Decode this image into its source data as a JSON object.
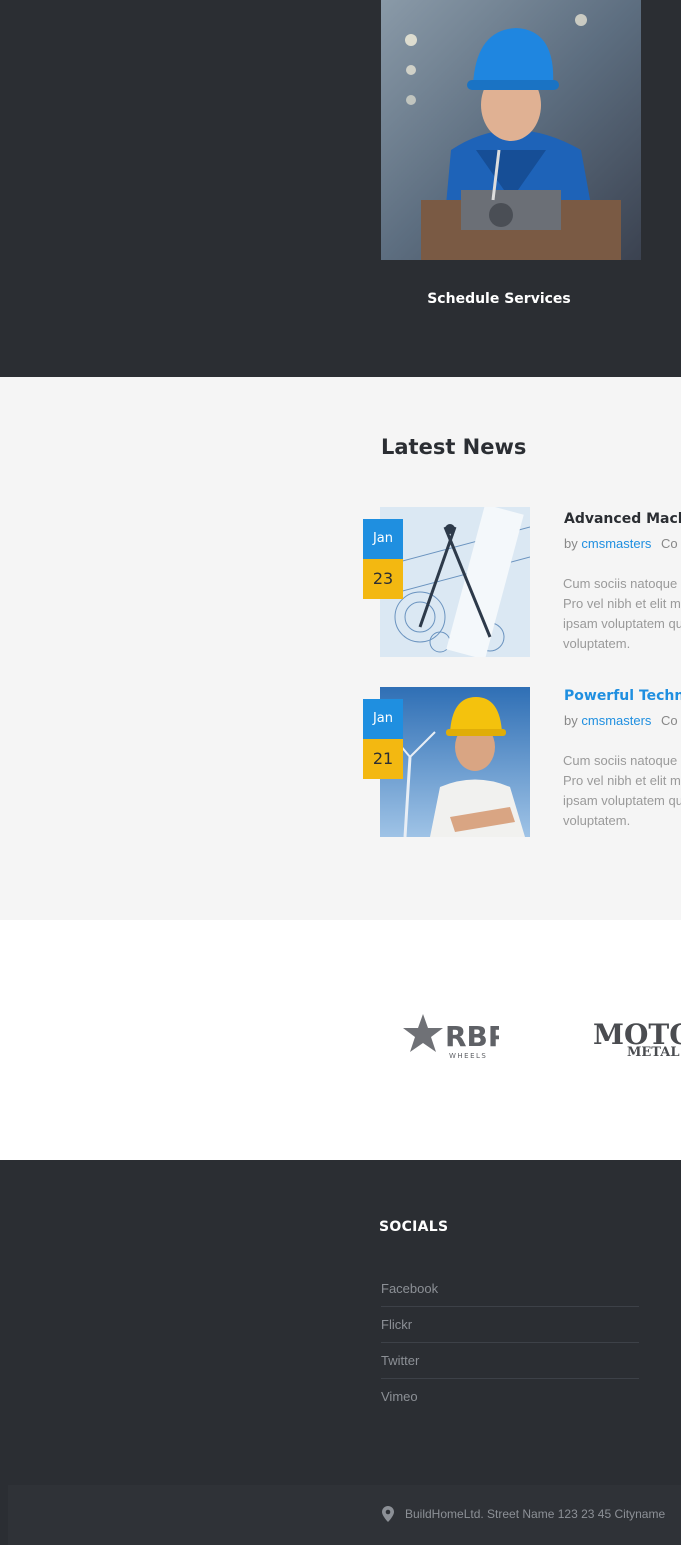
{
  "services": {
    "item_title": "Schedule Services"
  },
  "news": {
    "heading": "Latest News",
    "posts": [
      {
        "month": "Jan",
        "day": "23",
        "title": "Advanced Mach",
        "by": "by",
        "author": "cmsmasters",
        "category": "Co",
        "excerpt": [
          "Cum sociis natoque",
          "Pro vel nibh et elit m",
          "ipsam voluptatem qu",
          "voluptatem."
        ]
      },
      {
        "month": "Jan",
        "day": "21",
        "title": "Powerful Techni",
        "by": "by",
        "author": "cmsmasters",
        "category": "Co",
        "excerpt": [
          "Cum sociis natoque",
          "Pro vel nibh et elit m",
          "ipsam voluptatem qu",
          "voluptatem."
        ]
      }
    ]
  },
  "partners": {
    "logos": [
      {
        "name": "RBP",
        "sub": "WHEELS"
      },
      {
        "name": "MOTO",
        "sub": "METAL"
      }
    ]
  },
  "footer": {
    "socials_title": "SOCIALS",
    "socials": [
      "Facebook",
      "Flickr",
      "Twitter",
      "Vimeo"
    ],
    "address": "BuildHomeLtd.  Street Name 123   23 45 Cityname"
  },
  "colors": {
    "dark_bg": "#2b2e33",
    "accent_blue": "#1f8fe0",
    "accent_yellow": "#f3b811"
  }
}
